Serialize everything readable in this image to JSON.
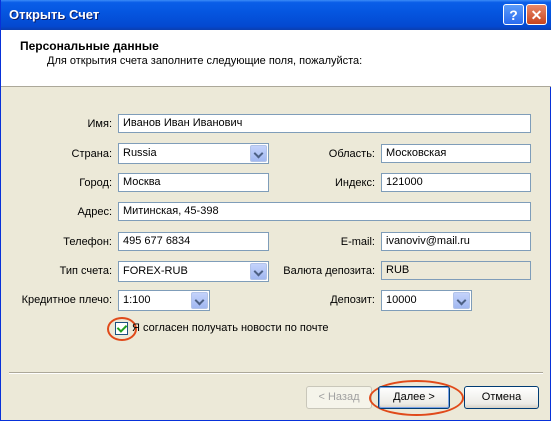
{
  "window": {
    "title": "Открыть Счет"
  },
  "header": {
    "title": "Персональные данные",
    "subtitle": "Для открытия счета заполните следующие поля, пожалуйста:"
  },
  "form": {
    "name": {
      "label": "Имя:",
      "value": "Иванов Иван Иванович"
    },
    "country": {
      "label": "Страна:",
      "value": "Russia"
    },
    "region": {
      "label": "Область:",
      "value": "Московская"
    },
    "city": {
      "label": "Город:",
      "value": "Москва"
    },
    "zip": {
      "label": "Индекс:",
      "value": "121000"
    },
    "address": {
      "label": "Адрес:",
      "value": "Митинская, 45-398"
    },
    "phone": {
      "label": "Телефон:",
      "value": "495 677 6834"
    },
    "email": {
      "label": "E-mail:",
      "value": "ivanoviv@mail.ru"
    },
    "account_type": {
      "label": "Тип счета:",
      "value": "FOREX-RUB"
    },
    "currency": {
      "label": "Валюта депозита:",
      "value": "RUB"
    },
    "leverage": {
      "label": "Кредитное плечо:",
      "value": "1:100"
    },
    "deposit": {
      "label": "Депозит:",
      "value": "10000"
    },
    "newsletter": {
      "label": "Я согласен получать новости по почте",
      "checked": true
    }
  },
  "buttons": {
    "back": "< Назад",
    "next": "Далее >",
    "cancel": "Отмена"
  },
  "colors": {
    "highlight_ring": "#e04a1a",
    "titlebar": "#0556e0"
  }
}
